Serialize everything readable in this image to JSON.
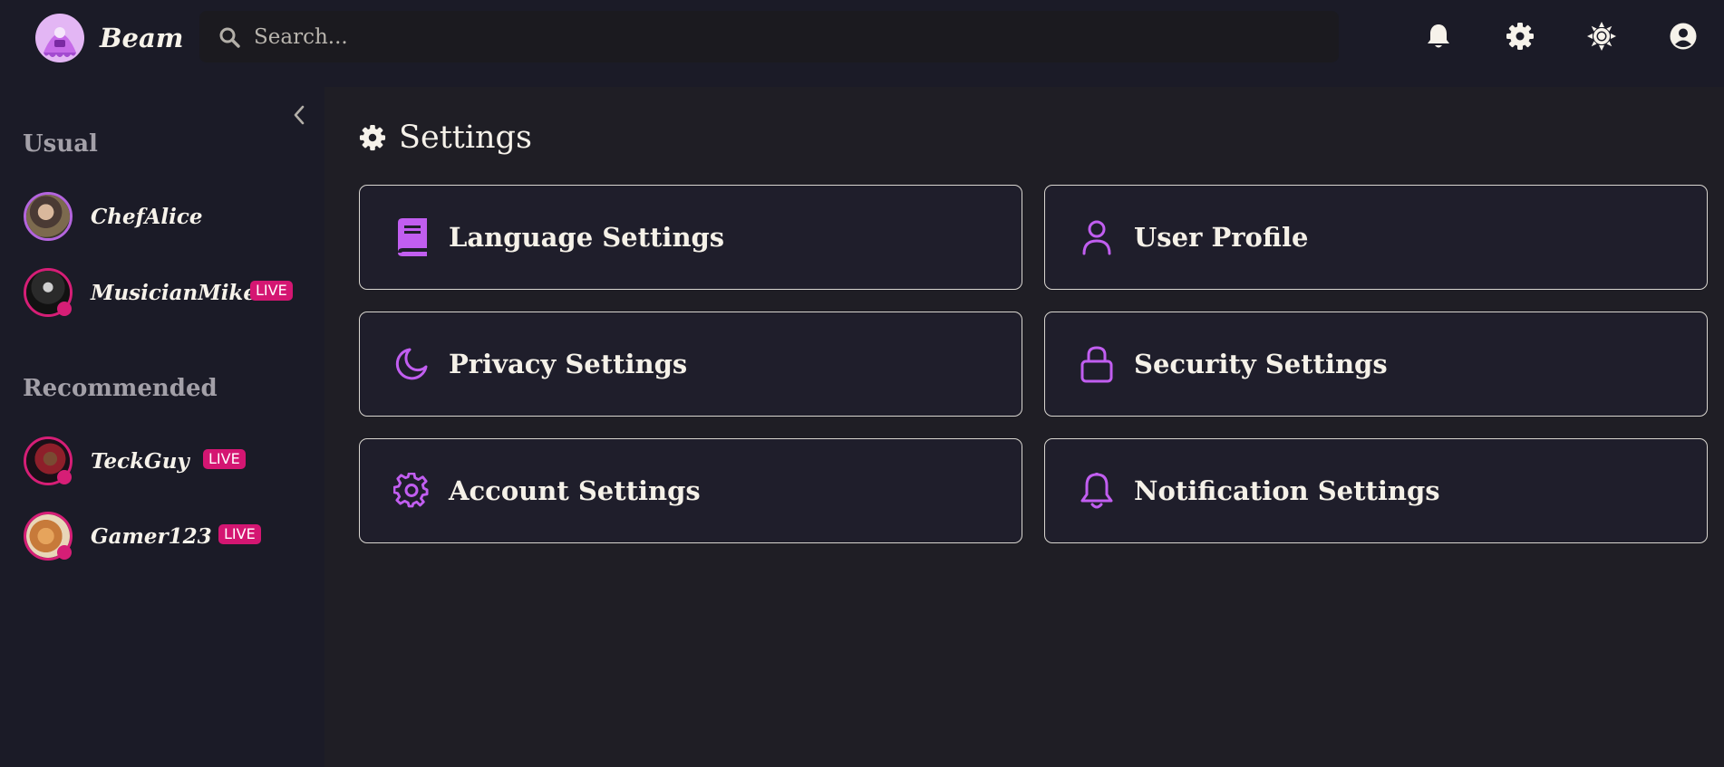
{
  "header": {
    "brand": "Beam",
    "search_placeholder": "Search...",
    "icons": [
      "bell-icon",
      "gear-icon",
      "sun-icon",
      "user-circle-icon"
    ]
  },
  "sidebar": {
    "sections": [
      {
        "title": "Usual",
        "channels": [
          {
            "name": "ChefAlice",
            "live": false
          },
          {
            "name": "MusicianMike",
            "live": true,
            "badge": "LIVE"
          }
        ]
      },
      {
        "title": "Recommended",
        "channels": [
          {
            "name": "TeckGuy",
            "live": true,
            "badge": "LIVE"
          },
          {
            "name": "Gamer123",
            "live": true,
            "badge": "LIVE"
          }
        ]
      }
    ]
  },
  "main": {
    "title": "Settings",
    "cards": [
      {
        "label": "Language Settings",
        "icon": "book-icon"
      },
      {
        "label": "User Profile",
        "icon": "user-icon"
      },
      {
        "label": "Privacy Settings",
        "icon": "moon-icon"
      },
      {
        "label": "Security Settings",
        "icon": "lock-icon"
      },
      {
        "label": "Account Settings",
        "icon": "cog-icon"
      },
      {
        "label": "Notification Settings",
        "icon": "bell-outline-icon"
      }
    ]
  },
  "colors": {
    "accent": "#c15ef0",
    "live": "#d41672",
    "background": "#1f1e25",
    "panel": "#1b1b27"
  }
}
